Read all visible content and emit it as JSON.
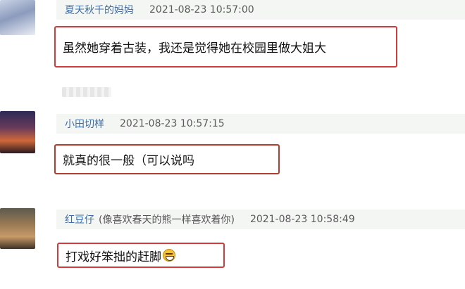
{
  "comments": [
    {
      "user": "夏天秋千的妈妈",
      "note": "",
      "time": "2021-08-23 10:57:00",
      "text": "虽然她穿着古装，我还是觉得她在校园里做大姐大"
    },
    {
      "user": "小田切样",
      "note": "",
      "time": "2021-08-23 10:57:15",
      "text": "就真的很一般（可以说吗"
    },
    {
      "user": "红豆仔",
      "note": "(像喜欢春天的熊一样喜欢着你)",
      "time": "2021-08-23 10:58:49",
      "text": "打戏好笨拙的赶脚",
      "emoji": "grinning-face-emoji"
    }
  ],
  "colors": {
    "username": "#3f6ea8",
    "highlight_border": "#d23b3b",
    "header_bg": "#f4f6f4"
  }
}
